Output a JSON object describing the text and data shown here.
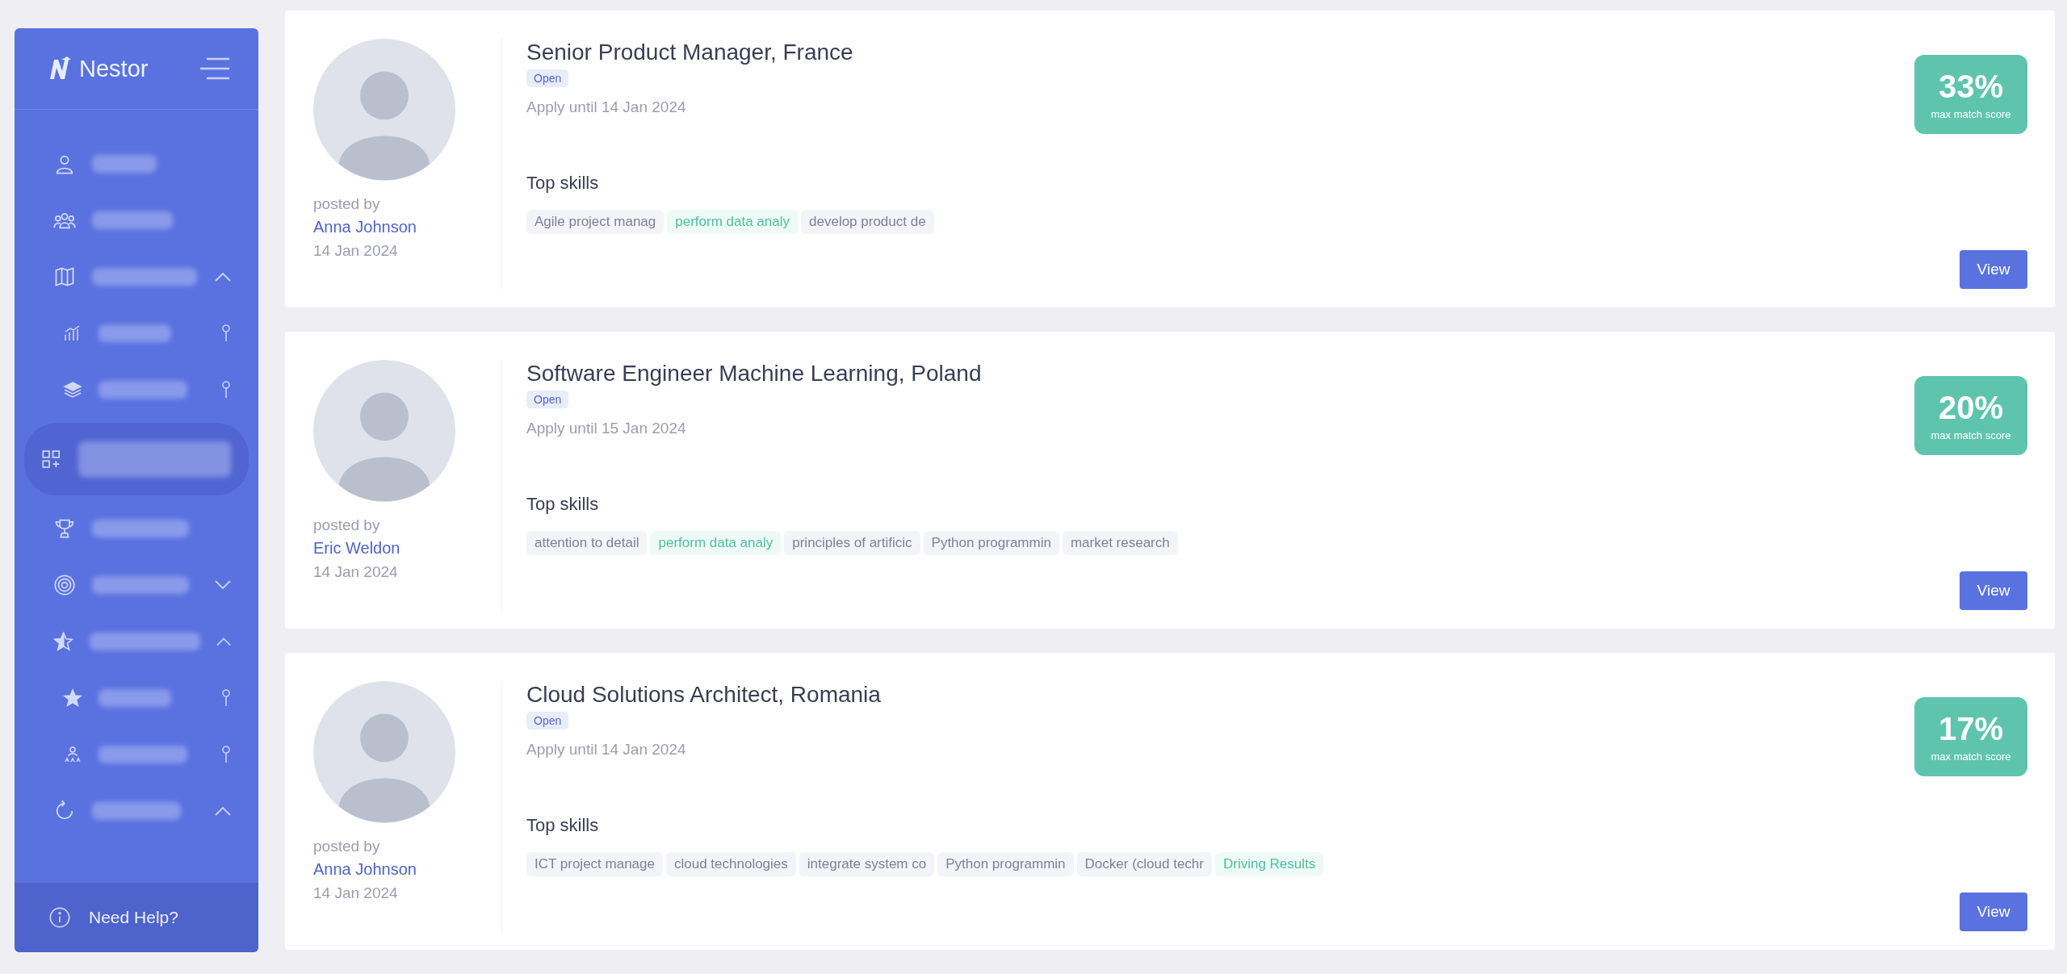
{
  "sidebar": {
    "logo": "Nestor",
    "items": [
      {
        "selected": false
      },
      {
        "selected": false
      },
      {
        "selected": false,
        "expanded": true,
        "children": [
          {
            "selected": false
          },
          {
            "selected": false
          }
        ]
      },
      {
        "selected": true
      },
      {
        "selected": false
      },
      {
        "selected": false,
        "expanded": false
      },
      {
        "selected": false,
        "expanded": true,
        "children": [
          {
            "selected": false
          },
          {
            "selected": false
          }
        ]
      },
      {
        "selected": false,
        "expanded": true
      }
    ],
    "help": "Need Help?"
  },
  "jobs": [
    {
      "title": "Senior Product Manager, France",
      "status": "Open",
      "deadline": "Apply until 14 Jan 2024",
      "posted_label": "posted by",
      "author": "Anna Johnson",
      "posted_date": "14 Jan 2024",
      "skills_heading": "Top skills",
      "skills": [
        {
          "name": "Agile project manag",
          "matched": false
        },
        {
          "name": "perform data analy",
          "matched": true
        },
        {
          "name": "develop product de",
          "matched": false
        }
      ],
      "score": "33%",
      "score_label": "max match score",
      "button": "View"
    },
    {
      "title": "Software Engineer Machine Learning, Poland",
      "status": "Open",
      "deadline": "Apply until 15 Jan 2024",
      "posted_label": "posted by",
      "author": "Eric Weldon",
      "posted_date": "14 Jan 2024",
      "skills_heading": "Top skills",
      "skills": [
        {
          "name": "attention to detail",
          "matched": false
        },
        {
          "name": "perform data analy",
          "matched": true
        },
        {
          "name": "principles of artificic",
          "matched": false
        },
        {
          "name": "Python programmin",
          "matched": false
        },
        {
          "name": "market research",
          "matched": false
        }
      ],
      "score": "20%",
      "score_label": "max match score",
      "button": "View"
    },
    {
      "title": "Cloud Solutions Architect, Romania",
      "status": "Open",
      "deadline": "Apply until 14 Jan 2024",
      "posted_label": "posted by",
      "author": "Anna Johnson",
      "posted_date": "14 Jan 2024",
      "skills_heading": "Top skills",
      "skills": [
        {
          "name": "ICT project manage",
          "matched": false
        },
        {
          "name": "cloud technologies",
          "matched": false
        },
        {
          "name": "integrate system co",
          "matched": false
        },
        {
          "name": "Python programmin",
          "matched": false
        },
        {
          "name": "Docker (cloud techr",
          "matched": false
        },
        {
          "name": "Driving Results",
          "matched": true
        }
      ],
      "score": "17%",
      "score_label": "max match score",
      "button": "View"
    }
  ]
}
